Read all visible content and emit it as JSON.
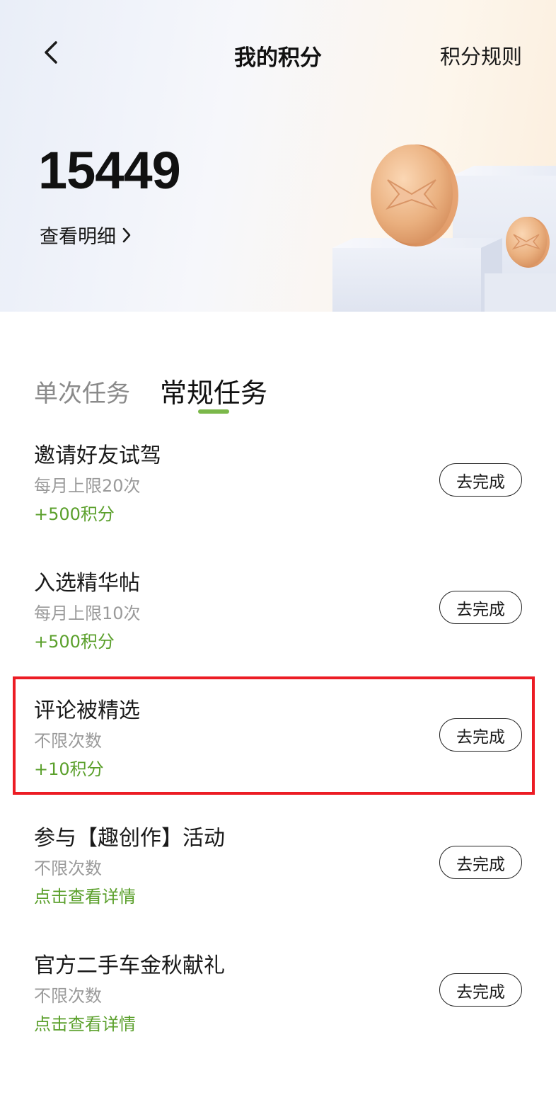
{
  "header": {
    "title": "我的积分",
    "rules_label": "积分规则"
  },
  "summary": {
    "points": "15449",
    "detail_label": "查看明细"
  },
  "tabs": [
    {
      "label": "单次任务",
      "active": false
    },
    {
      "label": "常规任务",
      "active": true
    }
  ],
  "tasks": [
    {
      "title": "邀请好友试驾",
      "limit": "每月上限20次",
      "reward": "+500积分",
      "button": "去完成"
    },
    {
      "title": "入选精华帖",
      "limit": "每月上限10次",
      "reward": "+500积分",
      "button": "去完成"
    },
    {
      "title": "评论被精选",
      "limit": "不限次数",
      "reward": "+10积分",
      "button": "去完成"
    },
    {
      "title": "参与【趣创作】活动",
      "limit": "不限次数",
      "reward": "点击查看详情",
      "button": "去完成"
    },
    {
      "title": "官方二手车金秋献礼",
      "limit": "不限次数",
      "reward": "点击查看详情",
      "button": "去完成"
    }
  ],
  "colors": {
    "accent_green": "#5ba02c",
    "tab_indicator": "#7bb84a",
    "highlight_red": "#ec1c24"
  }
}
